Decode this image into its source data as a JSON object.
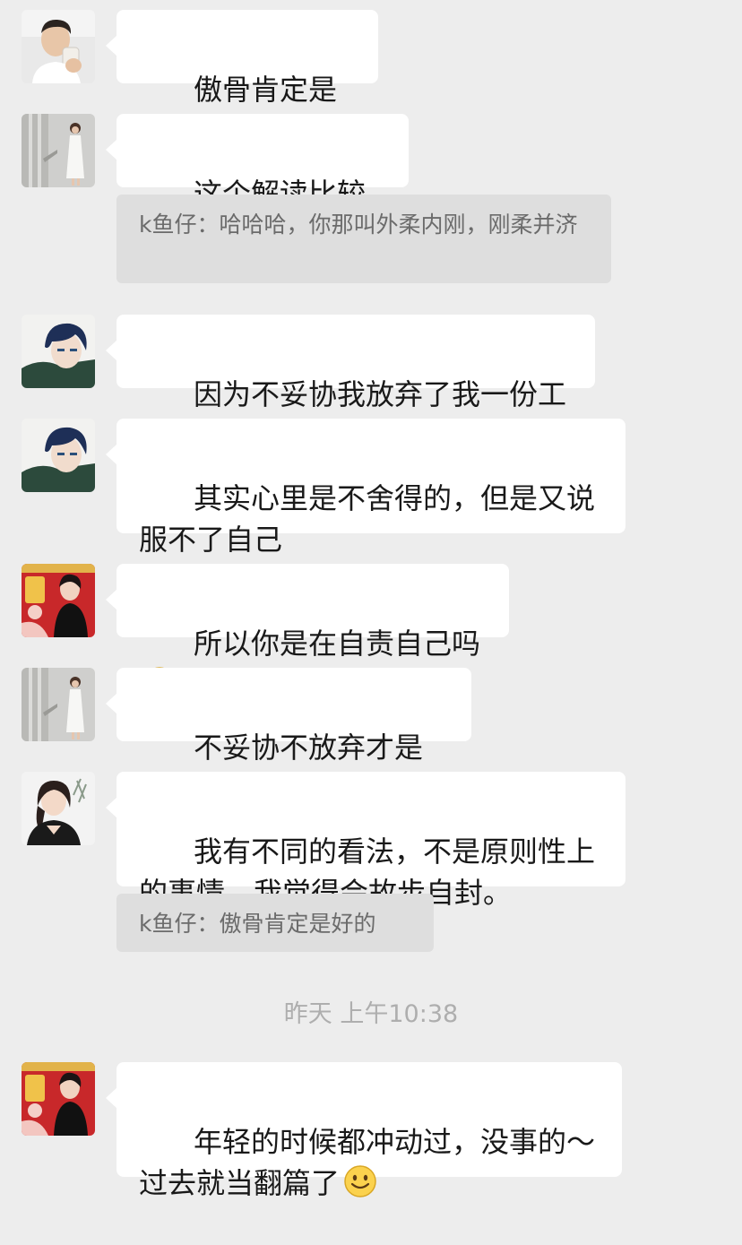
{
  "messages": [
    {
      "avatar": "man-drinking-avatar",
      "text": "傲骨肯定是好的"
    },
    {
      "avatar": "woman-white-dress-avatar",
      "text": "这个解读比较全面",
      "quote": "k鱼仔：哈哈哈，你那叫外柔内刚，刚柔并济"
    },
    {
      "avatar": "anime-boy-avatar",
      "text": "因为不妥协我放弃了我一份工作"
    },
    {
      "avatar": "anime-boy-avatar",
      "text": "其实心里是不舍得的，但是又说服不了自己"
    },
    {
      "avatar": "woman-red-background-avatar",
      "text": "所以你是在自责自己吗",
      "emoji": "smile-emoji"
    },
    {
      "avatar": "woman-white-dress-avatar",
      "text": "不妥协不放弃才是傲骨"
    },
    {
      "avatar": "woman-black-top-avatar",
      "text": "我有不同的看法，不是原则性上的事情，我觉得会故步自封。",
      "quote": "k鱼仔：傲骨肯定是好的"
    },
    {
      "avatar": "woman-red-background-avatar",
      "text": "年轻的时候都冲动过，没事的～过去就当翻篇了",
      "emoji": "smile-emoji"
    }
  ],
  "timestamp": "昨天 上午10:38",
  "colors": {
    "background": "#ededed",
    "bubble": "#ffffff",
    "quote_background": "#dedede",
    "quote_text": "#6b6b6b",
    "timestamp": "#aeaeae"
  }
}
